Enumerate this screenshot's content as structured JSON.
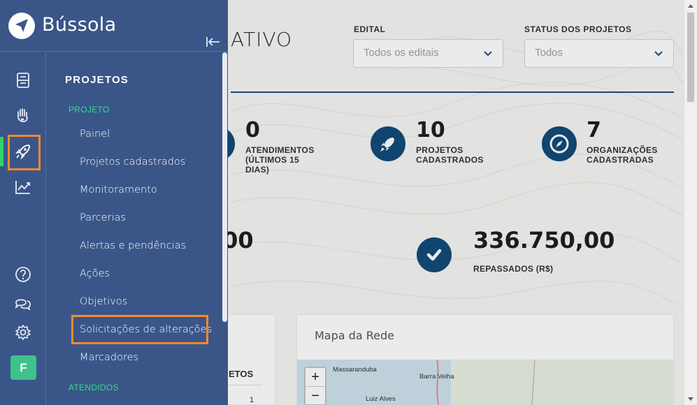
{
  "app": {
    "name": "Bússola"
  },
  "dashboard": {
    "title_fragment": "ATIVO",
    "filters": [
      {
        "label": "EDITAL",
        "value": "Todos os editais"
      },
      {
        "label": "STATUS DOS PROJETOS",
        "value": "Todos"
      }
    ],
    "stats": [
      {
        "value": "0",
        "label_lines": [
          "ATENDIMENTOS",
          "(ÚLTIMOS 15",
          "DIAS)"
        ],
        "icon": "headset-icon"
      },
      {
        "value": "10",
        "label_lines": [
          "PROJETOS",
          "CADASTRADOS"
        ],
        "icon": "rocket-icon"
      },
      {
        "value": "7",
        "label_lines": [
          "ORGANIZAÇÕES",
          "CADASTRADAS"
        ],
        "icon": "compass-icon"
      }
    ],
    "amounts": [
      {
        "value": ",00",
        "label": ""
      },
      {
        "value": "336.750,00",
        "label": "REPASSADOS (R$)",
        "icon": "check-icon"
      }
    ],
    "table_card": {
      "header": "ETOS",
      "cell": "1"
    },
    "map_card": {
      "title": "Mapa da Rede",
      "places": [
        "Massaranduba",
        "Barra Velha",
        "Luiz Alves"
      ],
      "zoom_in": "+",
      "zoom_out": "−"
    }
  },
  "sidebar": {
    "rail": [
      {
        "name": "documents",
        "icon": "document-icon"
      },
      {
        "name": "support",
        "icon": "hand-heart-icon"
      },
      {
        "name": "projects",
        "icon": "rocket-icon",
        "active": true
      },
      {
        "name": "reports",
        "icon": "trend-chart-icon"
      },
      {
        "name": "help",
        "icon": "question-icon"
      },
      {
        "name": "chat",
        "icon": "chat-icon"
      },
      {
        "name": "settings",
        "icon": "gear-icon"
      }
    ],
    "avatar": "F",
    "menu": {
      "heading": "PROJETOS",
      "group": "PROJETO",
      "items": [
        "Painel",
        "Projetos cadastrados",
        "Monitoramento",
        "Parcerias",
        "Alertas e pendências",
        "Ações",
        "Objetivos",
        "Solicitações de alterações",
        "Marcadores"
      ],
      "next_group": "ATENDIDOS"
    }
  },
  "colors": {
    "sidebar": "#3a5689",
    "accent_green": "#2fd26f",
    "highlight_orange": "#f58a2b",
    "stat_icon": "#124b79"
  }
}
